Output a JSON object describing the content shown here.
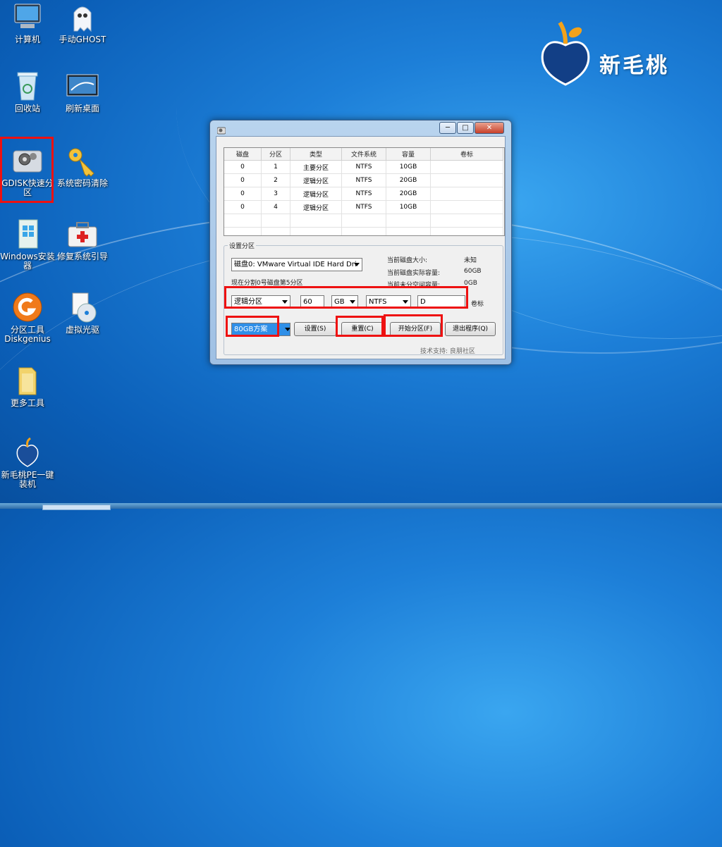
{
  "desktop_icons": [
    {
      "label": "计算机",
      "icon": "computer-icon"
    },
    {
      "label": "手动GHOST",
      "icon": "ghost-icon"
    },
    {
      "label": "回收站",
      "icon": "recycle-bin-icon"
    },
    {
      "label": "刷新桌面",
      "icon": "refresh-desktop-icon"
    },
    {
      "label": "GDISK快速分区",
      "icon": "gdisk-icon"
    },
    {
      "label": "系统密码清除",
      "icon": "key-icon"
    },
    {
      "label": "Windows安装器",
      "icon": "windows-installer-icon"
    },
    {
      "label": "修复系统引导",
      "icon": "repair-kit-icon"
    },
    {
      "label": "分区工具Diskgenius",
      "icon": "diskgenius-icon"
    },
    {
      "label": "虚拟光驱",
      "icon": "virtual-drive-icon"
    },
    {
      "label": "更多工具",
      "icon": "folder-icon"
    },
    {
      "label": "新毛桃PE一键装机",
      "icon": "xinmaotao-peach-icon"
    }
  ],
  "brand": {
    "text": "新毛桃",
    "icon": "peach-logo-icon"
  },
  "window": {
    "controls": {
      "minimize": "─",
      "maximize": "□",
      "close": "✕"
    },
    "table": {
      "headers": [
        "磁盘",
        "分区",
        "类型",
        "文件系统",
        "容量",
        "卷标"
      ],
      "rows": [
        [
          "0",
          "1",
          "主要分区",
          "NTFS",
          "10GB",
          ""
        ],
        [
          "0",
          "2",
          "逻辑分区",
          "NTFS",
          "20GB",
          ""
        ],
        [
          "0",
          "3",
          "逻辑分区",
          "NTFS",
          "20GB",
          ""
        ],
        [
          "0",
          "4",
          "逻辑分区",
          "NTFS",
          "10GB",
          ""
        ]
      ]
    },
    "settings": {
      "legend": "设置分区",
      "disk_select": "磁盘0: VMware Virtual IDE Hard Dri",
      "split_info": "现在分割0号磁盘第5分区",
      "info_labels": {
        "size": "当前磁盘大小:",
        "actual": "当前磁盘实际容量:",
        "unalloc": "当前未分空间容量:"
      },
      "info_values": {
        "size": "未知",
        "actual": "60GB",
        "unalloc": "0GB"
      },
      "part_type": "逻辑分区",
      "part_size": "60",
      "unit": "GB",
      "fs": "NTFS",
      "volume_label": "D",
      "volume_label_caption": "卷标",
      "scheme": "80GB方案",
      "buttons": {
        "set": "设置(S)",
        "reset": "重置(C)",
        "start": "开始分区(F)",
        "exit": "退出程序(Q)"
      },
      "support": "技术支持: 良朋社区"
    }
  },
  "colors": {
    "highlight": "#e11111",
    "selection": "#2f8fe8"
  }
}
